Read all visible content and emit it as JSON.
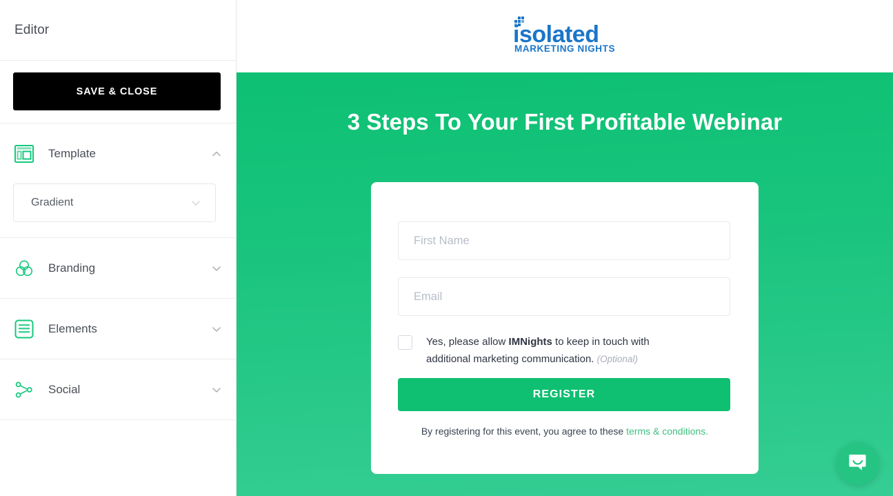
{
  "sidebar": {
    "title": "Editor",
    "save_label": "SAVE & CLOSE",
    "sections": [
      {
        "label": "Template",
        "icon": "template-icon",
        "expanded": true
      },
      {
        "label": "Branding",
        "icon": "branding-icon",
        "expanded": false
      },
      {
        "label": "Elements",
        "icon": "elements-icon",
        "expanded": false
      },
      {
        "label": "Social",
        "icon": "social-icon",
        "expanded": false
      }
    ],
    "template_select": {
      "value": "Gradient",
      "icon": "chevron-down-icon"
    }
  },
  "preview": {
    "logo": {
      "word": "isolated",
      "tagline": "MARKETING NIGHTS",
      "color": "#1a76c8"
    },
    "headline": "3 Steps To Your First Profitable Webinar",
    "form": {
      "first_name_placeholder": "First Name",
      "first_name_value": "",
      "email_placeholder": "Email",
      "email_value": "",
      "consent": {
        "prefix": "Yes, please allow ",
        "brand": "IMNights",
        "suffix": " to keep in touch with additional marketing communication. ",
        "optional": "(Optional)",
        "checked": false
      },
      "register_label": "REGISTER",
      "terms_prefix": "By registering for this event, you agree to these ",
      "terms_link": "terms & conditions.",
      "link_color": "#3fbf7f"
    },
    "chat": {
      "icon": "chat-bubble-smile-icon"
    },
    "colors": {
      "gradient_top": "#0dc073",
      "gradient_bottom": "#35cd93",
      "button": "#0fbf72"
    }
  }
}
